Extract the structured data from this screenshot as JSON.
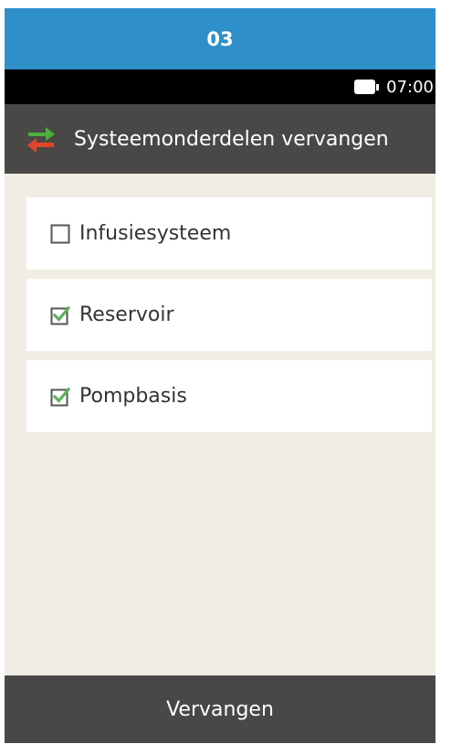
{
  "step": {
    "number": "03"
  },
  "status": {
    "time": "07:00",
    "battery_icon": "battery-icon"
  },
  "header": {
    "title": "Systeemonderdelen vervangen",
    "icon": "swap-arrows-icon"
  },
  "items": [
    {
      "label": "Infusiesysteem",
      "checked": false
    },
    {
      "label": "Reservoir",
      "checked": true
    },
    {
      "label": "Pompbasis",
      "checked": true
    }
  ],
  "footer": {
    "button_label": "Vervangen"
  },
  "colors": {
    "step_bar": "#2e8fc9",
    "header": "#4a4846",
    "content_bg": "#f1ede4",
    "check_green": "#5bb35a",
    "arrow_green": "#4caf3e",
    "arrow_red": "#e2452a"
  }
}
